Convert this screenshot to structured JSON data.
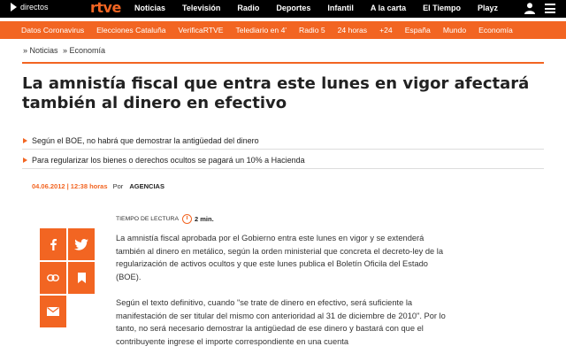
{
  "topbar": {
    "live_label": "directos",
    "logo": "rtve",
    "nav": [
      "Noticias",
      "Televisión",
      "Radio",
      "Deportes",
      "Infantil",
      "A la carta",
      "El Tiempo",
      "Playz"
    ]
  },
  "subnav": [
    "Datos Coronavirus",
    "Elecciones Cataluña",
    "VerificaRTVE",
    "Telediario en 4'",
    "Radio 5",
    "24 horas",
    "+24",
    "España",
    "Mundo",
    "Economía"
  ],
  "breadcrumb": [
    "» Noticias",
    "» Economía"
  ],
  "headline": "La amnistía fiscal que entra este lunes en vigor afectará también al dinero en efectivo",
  "bullets": [
    "Según el BOE, no habrá que demostrar la antigüedad del dinero",
    "Para regularizar los bienes o derechos ocultos se pagará un 10% a Hacienda"
  ],
  "meta": {
    "date": "04.06.2012 | 12:38 horas",
    "by": "Por",
    "agency": "AGENCIAS"
  },
  "reading": {
    "label": "TIEMPO DE LECTURA",
    "minutes": "2 min."
  },
  "article": {
    "p1": "La amnistía fiscal aprobada por el Gobierno entra este lunes en vigor y se extenderá también al dinero en metálico, según la orden ministerial que concreta el decreto-ley de la regularización de activos ocultos y que este lunes publica el Boletín Oficila del Estado (BOE).",
    "p2": "Según el texto definitivo, cuando \"se trate de dinero en efectivo, será suficiente la manifestación de ser titular del mismo con anterioridad al 31 de diciembre de 2010\". Por lo tanto, no será necesario demostrar la antigüedad de ese dinero y bastará con que el contribuyente ingrese el importe correspondiente en una cuenta"
  },
  "colors": {
    "accent": "#f26522",
    "topbar": "#000000"
  },
  "icons": [
    "play-icon",
    "user-icon",
    "menu-icon",
    "facebook-icon",
    "twitter-icon",
    "link-icon",
    "bookmark-icon",
    "email-icon",
    "clock-icon"
  ]
}
